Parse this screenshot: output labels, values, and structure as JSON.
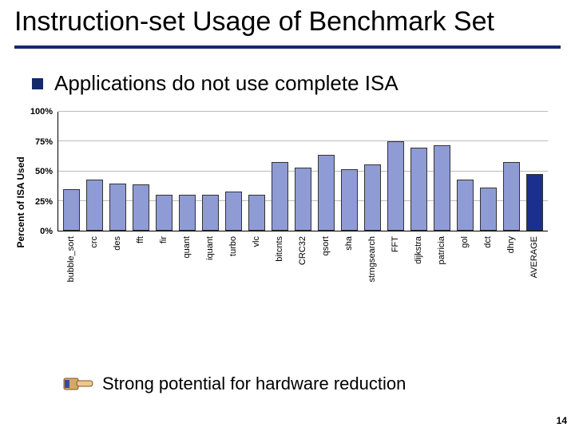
{
  "title": "Instruction-set Usage of Benchmark Set",
  "bullet": "Applications do not use complete ISA",
  "callout": "Strong potential for hardware reduction",
  "page_number": "14",
  "chart_data": {
    "type": "bar",
    "ylabel": "Percent of ISA Used",
    "ylim": [
      0,
      100
    ],
    "yticks": [
      "0%",
      "25%",
      "50%",
      "75%",
      "100%"
    ],
    "categories": [
      "bubble_sort",
      "crc",
      "des",
      "fft",
      "fir",
      "quant",
      "iquant",
      "turbo",
      "vlc",
      "bitcnts",
      "CRC32",
      "qsort",
      "sha",
      "strngsearch",
      "FFT",
      "dijkstra",
      "patricia",
      "gol",
      "dct",
      "dhry",
      "AVERAGE"
    ],
    "values": [
      35,
      43,
      40,
      39,
      30,
      30,
      30,
      33,
      30,
      58,
      53,
      64,
      52,
      56,
      75,
      70,
      72,
      43,
      36,
      58,
      48
    ],
    "highlight_index": 20
  }
}
